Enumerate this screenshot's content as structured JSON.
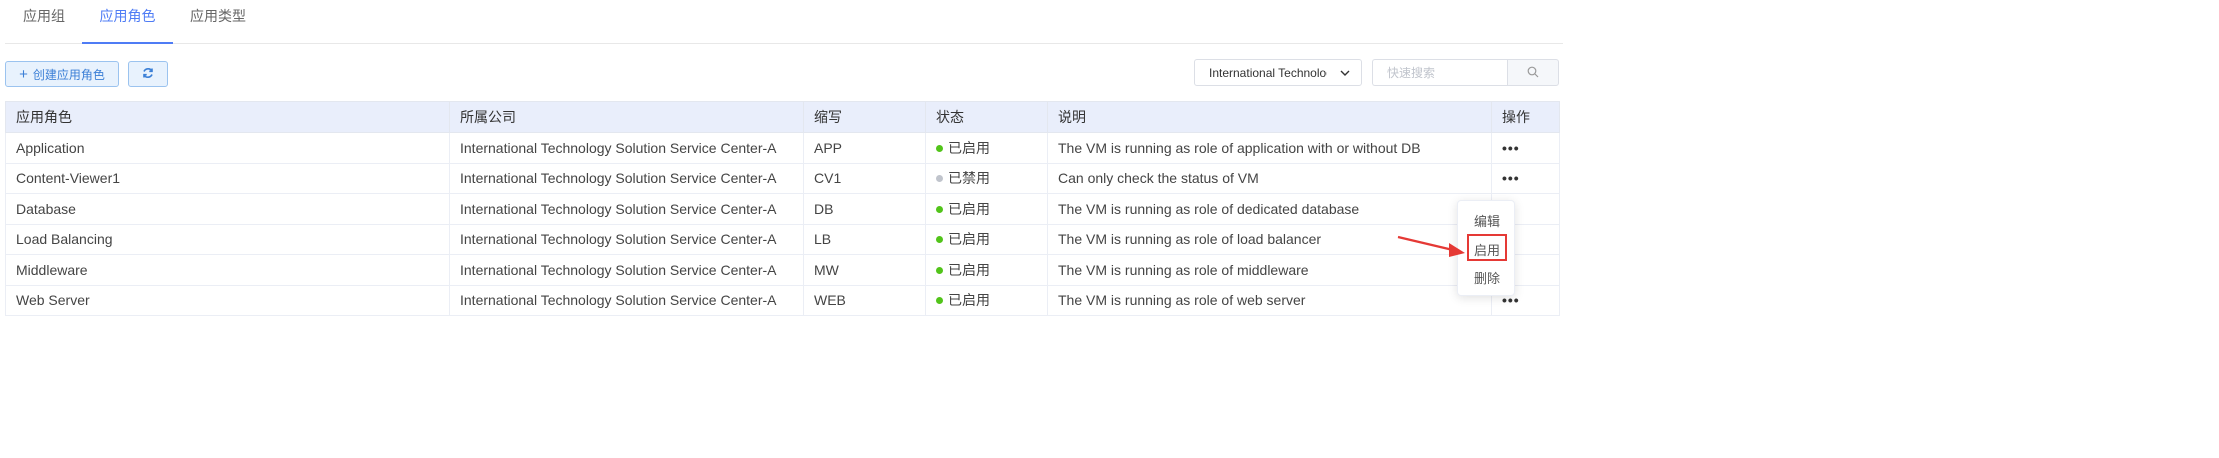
{
  "tabs": [
    {
      "label": "应用组"
    },
    {
      "label": "应用角色"
    },
    {
      "label": "应用类型"
    }
  ],
  "toolbar": {
    "create_label": "创建应用角色",
    "company_select": "International Technology Solution Service Center-A",
    "search_placeholder": "快速搜索"
  },
  "table": {
    "headers": [
      "应用角色",
      "所属公司",
      "缩写",
      "状态",
      "说明",
      "操作"
    ],
    "rows": [
      {
        "role": "Application",
        "company": "International Technology Solution Service Center-A",
        "abbr": "APP",
        "status": "已启用",
        "enabled": true,
        "desc": "The VM is running as role of application with or without DB",
        "action": "•••"
      },
      {
        "role": "Content-Viewer1",
        "company": "International Technology Solution Service Center-A",
        "abbr": "CV1",
        "status": "已禁用",
        "enabled": false,
        "desc": "Can only check the status of VM",
        "action": "•••"
      },
      {
        "role": "Database",
        "company": "International Technology Solution Service Center-A",
        "abbr": "DB",
        "status": "已启用",
        "enabled": true,
        "desc": "The VM is running as role of dedicated database",
        "action": ""
      },
      {
        "role": "Load Balancing",
        "company": "International Technology Solution Service Center-A",
        "abbr": "LB",
        "status": "已启用",
        "enabled": true,
        "desc": "The VM is running as role of load balancer",
        "action": ""
      },
      {
        "role": "Middleware",
        "company": "International Technology Solution Service Center-A",
        "abbr": "MW",
        "status": "已启用",
        "enabled": true,
        "desc": "The VM is running as role of middleware",
        "action": ""
      },
      {
        "role": "Web Server",
        "company": "International Technology Solution Service Center-A",
        "abbr": "WEB",
        "status": "已启用",
        "enabled": true,
        "desc": "The VM is running as role of web server",
        "action": "•••"
      }
    ]
  },
  "dropdown": {
    "items": [
      "编辑",
      "启用",
      "删除"
    ]
  },
  "colors": {
    "accent": "#4f7cf5",
    "enabled": "#52c41a",
    "disabled": "#c0c4cc",
    "highlight": "#e53935"
  },
  "icons": [
    "plus-icon",
    "refresh-icon",
    "chevron-down-icon",
    "search-icon",
    "more-icon",
    "annotation-arrow"
  ]
}
